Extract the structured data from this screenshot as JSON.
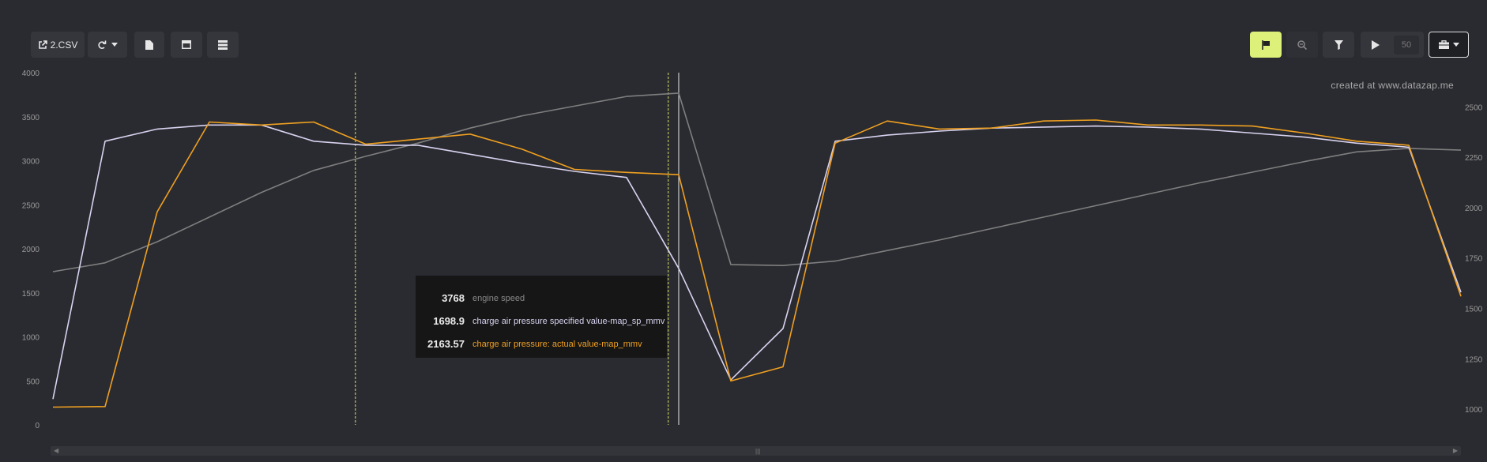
{
  "toolbar": {
    "file_label": "2.CSV",
    "frame_count": "50"
  },
  "icons": {
    "export": "external-link-icon",
    "refresh": "refresh-icon",
    "document": "file-icon",
    "layout": "window-icon",
    "list": "server-list-icon",
    "flag": "flag-icon",
    "zoom": "zoom-out-icon",
    "filter": "filter-icon",
    "play": "play-icon",
    "briefcase": "briefcase-icon"
  },
  "colors": {
    "background": "#2a2b30",
    "engine_speed": "#7f7f7f",
    "specified": "#d8d2f0",
    "actual": "#f0a020",
    "flag_button": "#ddf07a"
  },
  "watermark": "created at www.datazap.me",
  "tooltip": {
    "rows": [
      {
        "value": "3768",
        "label": "engine speed",
        "color": "#888888"
      },
      {
        "value": "1698.9",
        "label": "charge air pressure specified value-map_sp_mmv",
        "color": "#d8d2f0"
      },
      {
        "value": "2163.57",
        "label": "charge air pressure: actual value-map_mmv",
        "color": "#f0a020"
      }
    ]
  },
  "chart_data": {
    "type": "line",
    "left_axis": {
      "ticks": [
        "0",
        "500",
        "1000",
        "1500",
        "2000",
        "2500",
        "3000",
        "3500",
        "4000"
      ],
      "ylim": [
        0,
        4000
      ]
    },
    "right_axis": {
      "ticks": [
        "1000",
        "1250",
        "1500",
        "1750",
        "2000",
        "2250",
        "2500"
      ],
      "ylim": [
        922,
        2670
      ]
    },
    "x": [
      0,
      1,
      2,
      3,
      4,
      5,
      6,
      7,
      8,
      9,
      10,
      11,
      12,
      13,
      14,
      15,
      16,
      17,
      18,
      19,
      20,
      21,
      22,
      23,
      24,
      25,
      26,
      27
    ],
    "series": [
      {
        "axis": "left",
        "color": "#7f7f7f",
        "values": [
          1740,
          1840,
          2080,
          2360,
          2640,
          2890,
          3050,
          3200,
          3370,
          3510,
          3620,
          3730,
          3768,
          1820,
          1810,
          1860,
          1980,
          2100,
          2230,
          2360,
          2490,
          2620,
          2750,
          2870,
          2990,
          3100,
          3140,
          3120
        ]
      },
      {
        "axis": "right",
        "color": "#d8d2f0",
        "values": [
          1050,
          2330,
          2390,
          2410,
          2410,
          2330,
          2310,
          2310,
          2265,
          2220,
          2180,
          2150,
          1698.9,
          1145,
          1400,
          2330,
          2360,
          2380,
          2395,
          2400,
          2405,
          2400,
          2390,
          2370,
          2350,
          2320,
          2300,
          1580
        ]
      },
      {
        "axis": "right",
        "color": "#f0a020",
        "values": [
          1010,
          1013,
          1980,
          2425,
          2410,
          2425,
          2315,
          2340,
          2365,
          2290,
          2190,
          2175,
          2163.57,
          1140,
          1210,
          2320,
          2430,
          2390,
          2395,
          2430,
          2435,
          2410,
          2410,
          2405,
          2370,
          2330,
          2310,
          1560
        ]
      }
    ],
    "markers": {
      "dashed_x": [
        5.8,
        11.8
      ],
      "cursor_x": 12
    }
  }
}
